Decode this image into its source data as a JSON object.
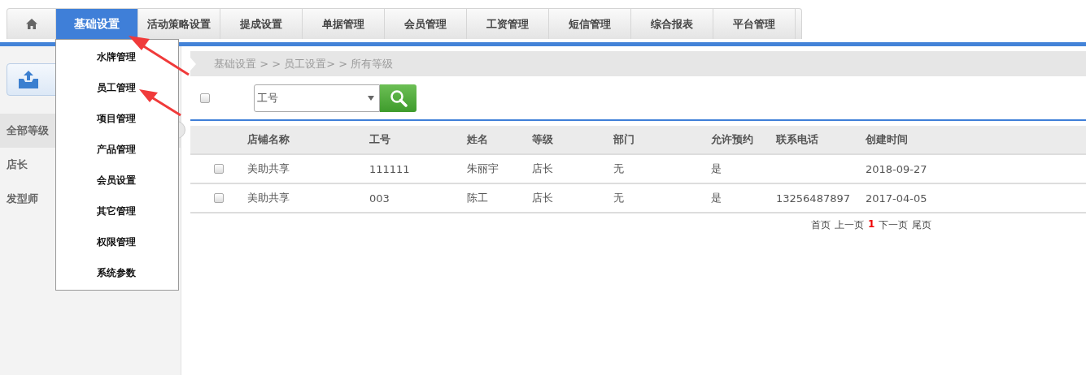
{
  "nav": {
    "tabs": [
      {
        "kind": "home",
        "selected": false
      },
      {
        "kind": "text",
        "label": "基础设置",
        "selected": true
      },
      {
        "kind": "text",
        "label": "活动策略设置",
        "selected": false
      },
      {
        "kind": "text",
        "label": "提成设置",
        "selected": false
      },
      {
        "kind": "text",
        "label": "单据管理",
        "selected": false
      },
      {
        "kind": "text",
        "label": "会员管理",
        "selected": false
      },
      {
        "kind": "text",
        "label": "工资管理",
        "selected": false
      },
      {
        "kind": "text",
        "label": "短信管理",
        "selected": false
      },
      {
        "kind": "text",
        "label": "综合报表",
        "selected": false
      },
      {
        "kind": "text",
        "label": "平台管理",
        "selected": false
      }
    ],
    "dropdown": [
      "水牌管理",
      "员工管理",
      "项目管理",
      "产品管理",
      "会员设置",
      "其它管理",
      "权限管理",
      "系统参数"
    ]
  },
  "sidebar": {
    "items": [
      {
        "label": "全部等级",
        "selected": true
      },
      {
        "label": "店长",
        "selected": false
      },
      {
        "label": "发型师",
        "selected": false
      }
    ]
  },
  "breadcrumb": "基础设置 > > 员工设置> > 所有等级",
  "toolbar": {
    "select_all": false,
    "search_field": "工号"
  },
  "table": {
    "columns": [
      "店铺名称",
      "工号",
      "姓名",
      "等级",
      "部门",
      "允许预约",
      "联系电话",
      "创建时间"
    ],
    "rows": [
      {
        "checked": false,
        "cells": [
          "美助共享",
          "111111",
          "朱丽宇",
          "店长",
          "无",
          "是",
          "",
          "2018-09-27"
        ]
      },
      {
        "checked": false,
        "cells": [
          "美助共享",
          "003",
          "陈工",
          "店长",
          "无",
          "是",
          "13256487897",
          "2017-04-05"
        ]
      }
    ]
  },
  "pagination": [
    {
      "kind": "link",
      "label": "首页"
    },
    {
      "kind": "link",
      "label": "上一页"
    },
    {
      "kind": "current",
      "label": "1"
    },
    {
      "kind": "link",
      "label": "下一页"
    },
    {
      "kind": "link",
      "label": "尾页"
    }
  ]
}
